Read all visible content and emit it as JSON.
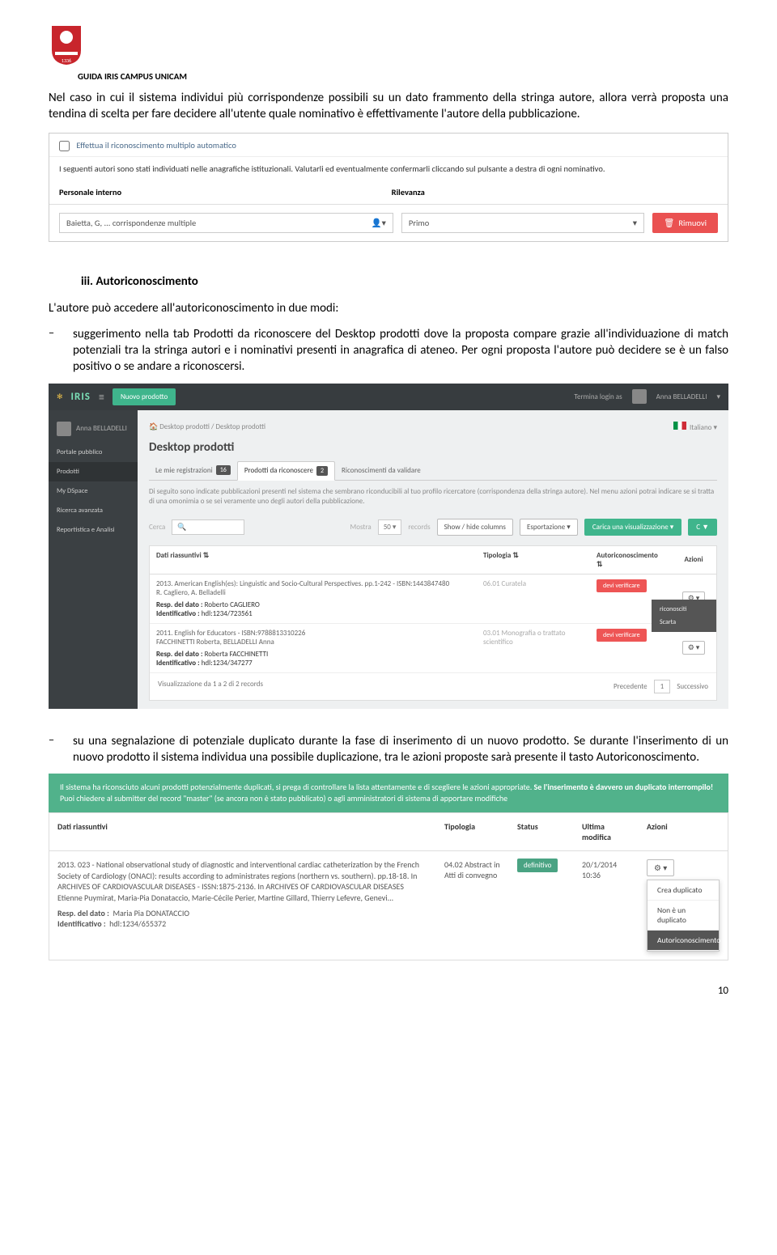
{
  "header": {
    "guide_title": "GUIDA IRIS CAMPUS UNICAM"
  },
  "intro_para": "Nel caso in cui il sistema individui più corrispondenze possibili su un dato frammento della stringa autore, allora verrà proposta una tendina di scelta per fare decidere all'utente quale nominativo è effettivamente l'autore della pubblicazione.",
  "ss1": {
    "checkbox_label": "Effettua il riconoscimento multiplo automatico",
    "desc": "I seguenti autori sono stati individuati nelle anagrafiche istituzionali. Valutarli ed eventualmente confermarli cliccando sul pulsante a destra di ogni nominativo.",
    "th_personale": "Personale interno",
    "th_rilevanza": "Rilevanza",
    "row_sel1": "Baietta, G, ... corrispondenze multiple",
    "row_sel2": "Primo",
    "btn_rimuovi": "Rimuovi"
  },
  "section_head": "iii.    Autoriconoscimento",
  "lead": "L'autore può accedere all'autoriconoscimento in due modi:",
  "bullet1_pre": "suggerimento nella tab ",
  "bullet1_em": "Prodotti da riconoscere",
  "bullet1_post": " del Desktop prodotti dove la proposta compare grazie all'individuazione di match potenziali tra la stringa autori e i nominativi presenti in anagrafica di ateneo. Per ogni proposta l'autore può decidere se è un falso positivo o se andare a riconoscersi.",
  "ss2": {
    "brand": "IRIS",
    "btn_new": "Nuovo prodotto",
    "termina": "Termina login as",
    "user": "Anna BELLADELLI",
    "side_user": "Anna BELLADELLI",
    "side_items": [
      "Portale pubblico",
      "Prodotti",
      "My DSpace",
      "Ricerca avanzata",
      "Reportistica e Analisi"
    ],
    "crumb": "Desktop prodotti  /  Desktop prodotti",
    "lang": "Italiano",
    "h1": "Desktop prodotti",
    "tabs": [
      {
        "label": "Le mie registrazioni",
        "badge": "16"
      },
      {
        "label": "Prodotti da riconoscere",
        "badge": "2"
      },
      {
        "label": "Riconoscimenti da validare",
        "badge": ""
      }
    ],
    "note": "Di seguito sono indicate pubblicazioni presenti nel sistema che sembrano riconducibili al tuo profilo ricercatore (corrispondenza della stringa autore). Nel menu azioni potrai indicare se si tratta di una omonimia o se sei veramente uno degli autori della pubblicazione.",
    "cerca": "Cerca",
    "mostra": "Mostra",
    "mostra_n": "50",
    "records": "records",
    "showhide": "Show / hide columns",
    "export": "Esportazione",
    "loadview": "Carica una visualizzazione",
    "th": [
      "Dati riassuntivi",
      "Tipologia",
      "Autoriconoscimento",
      "Azioni"
    ],
    "rows": [
      {
        "title": "2013. American English(es): Linguistic and Socio-Cultural Perspectives. pp.1-242 - ISBN:1443847480\nR. Cagliero, A. Belladelli",
        "resp": "Resp. del dato :",
        "resp_v": "Roberto CAGLIERO",
        "id": "Identificativo :",
        "id_v": "hdl:1234/723561",
        "tip": "06.01 Curatela",
        "auto": "devi verificare"
      },
      {
        "title": "2011. English for Educators - ISBN:9788813310226\nFACCHINETTI Roberta, BELLADELLI Anna",
        "resp": "Resp. del dato :",
        "resp_v": "Roberta FACCHINETTI",
        "id": "Identificativo :",
        "id_v": "hdl:1234/347277",
        "tip": "03.01 Monografia o trattato scientifico",
        "auto": "devi verificare",
        "menu": [
          "riconosciti",
          "Scarta"
        ]
      }
    ],
    "pager_info": "Visualizzazione da 1 a 2 di 2 records",
    "prev": "Precedente",
    "next": "Successivo"
  },
  "bullet2_pre": "su una segnalazione di potenziale duplicato durante la fase di inserimento di un nuovo prodotto. Se durante l'inserimento di un nuovo prodotto il sistema individua una possibile duplicazione, tra le azioni proposte sarà presente il tasto ",
  "bullet2_em": "Autoriconoscimento",
  "bullet2_post": ".",
  "ss3": {
    "alert_pre": "Il sistema ha riconsciuto alcuni prodotti potenzialmente duplicati, si prega di controllare la lista attentamente e di scegliere le azioni appropriate. ",
    "alert_bold": "Se l'inserimento è davvero un duplicato interrompilo!",
    "alert_post": " Puoi chiedere al submitter del record \"master\" (se ancora non è stato pubblicato) o agli amministratori di sistema di apportare modifiche",
    "th": [
      "Dati riassuntivi",
      "Tipologia",
      "Status",
      "Ultima modifica",
      "Azioni"
    ],
    "row": {
      "title": "2013. 023 - National observational study of diagnostic and interventional cardiac catheterization by the French Society of Cardiology (ONACI): results according to administrates regions (northern vs. southern). pp.18-18. In ARCHIVES OF CARDIOVASCULAR DISEASES - ISSN:1875-2136. In ARCHIVES OF CARDIOVASCULAR DISEASES\nEtienne Puymirat, Maria-Pia Donataccio, Marie-Cécile Perier, Martine Gillard, Thierry Lefevre, Genevi...",
      "resp": "Resp. del dato :",
      "resp_v": "Maria Pia DONATACCIO",
      "id": "Identificativo :",
      "id_v": "hdl:1234/655372",
      "tip": "04.02 Abstract in Atti di convegno",
      "status": "definitivo",
      "mod": "20/1/2014 10:36",
      "menu": [
        "Crea duplicato",
        "Non è un duplicato",
        "Autoriconoscimento"
      ]
    }
  },
  "page_num": "10"
}
